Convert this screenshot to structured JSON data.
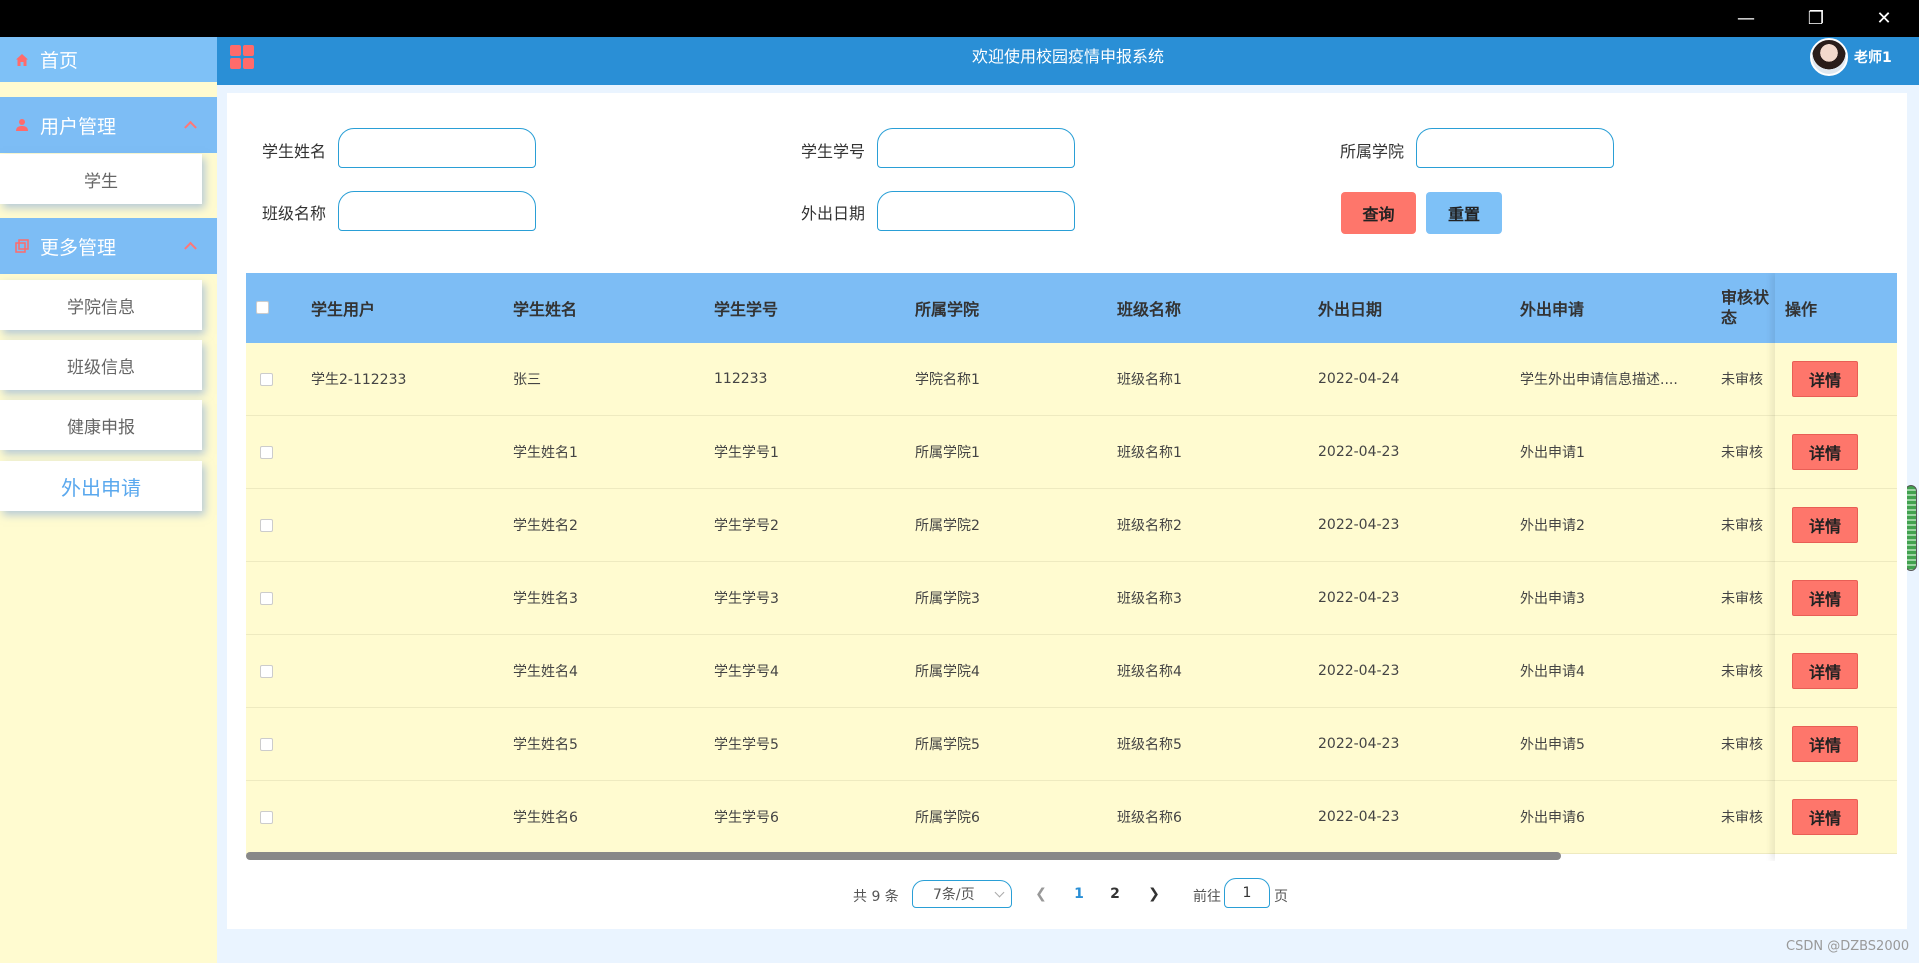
{
  "window": {
    "min": "—",
    "max": "❐",
    "close": "✕"
  },
  "sidebar": {
    "home": "首页",
    "groups": [
      {
        "label": "用户管理",
        "items": [
          "学生"
        ]
      },
      {
        "label": "更多管理",
        "items": [
          "学院信息",
          "班级信息",
          "健康申报",
          "外出申请"
        ]
      }
    ],
    "active_item": "外出申请"
  },
  "header": {
    "title": "欢迎使用校园疫情申报系统",
    "user": "老师1"
  },
  "search": {
    "student_name_label": "学生姓名",
    "student_no_label": "学生学号",
    "college_label": "所属学院",
    "class_label": "班级名称",
    "out_date_label": "外出日期",
    "query_button": "查询",
    "reset_button": "重置"
  },
  "table": {
    "columns": [
      "学生用户",
      "学生姓名",
      "学生学号",
      "所属学院",
      "班级名称",
      "外出日期",
      "外出申请",
      "审核状态",
      "操作"
    ],
    "rows": [
      {
        "user": "学生2-112233",
        "name": "张三",
        "no": "112233",
        "college": "学院名称1",
        "class": "班级名称1",
        "date": "2022-04-24",
        "apply": "学生外出申请信息描述....",
        "status": "未审核"
      },
      {
        "user": "",
        "name": "学生姓名1",
        "no": "学生学号1",
        "college": "所属学院1",
        "class": "班级名称1",
        "date": "2022-04-23",
        "apply": "外出申请1",
        "status": "未审核"
      },
      {
        "user": "",
        "name": "学生姓名2",
        "no": "学生学号2",
        "college": "所属学院2",
        "class": "班级名称2",
        "date": "2022-04-23",
        "apply": "外出申请2",
        "status": "未审核"
      },
      {
        "user": "",
        "name": "学生姓名3",
        "no": "学生学号3",
        "college": "所属学院3",
        "class": "班级名称3",
        "date": "2022-04-23",
        "apply": "外出申请3",
        "status": "未审核"
      },
      {
        "user": "",
        "name": "学生姓名4",
        "no": "学生学号4",
        "college": "所属学院4",
        "class": "班级名称4",
        "date": "2022-04-23",
        "apply": "外出申请4",
        "status": "未审核"
      },
      {
        "user": "",
        "name": "学生姓名5",
        "no": "学生学号5",
        "college": "所属学院5",
        "class": "班级名称5",
        "date": "2022-04-23",
        "apply": "外出申请5",
        "status": "未审核"
      },
      {
        "user": "",
        "name": "学生姓名6",
        "no": "学生学号6",
        "college": "所属学院6",
        "class": "班级名称6",
        "date": "2022-04-23",
        "apply": "外出申请6",
        "status": "未审核"
      }
    ],
    "detail_button": "详情"
  },
  "pagination": {
    "total": "共 9 条",
    "page_size": "7条/页",
    "pages": [
      "1",
      "2"
    ],
    "current": "1",
    "goto_prefix": "前往",
    "goto_value": "1",
    "goto_suffix": "页"
  },
  "watermark": "CSDN @DZBS2000",
  "colors": {
    "header": "#2a8fd6",
    "sidebar_bg": "#fffbd0",
    "menu_blue": "#7dbdf5",
    "accent_red": "#fe766b"
  }
}
